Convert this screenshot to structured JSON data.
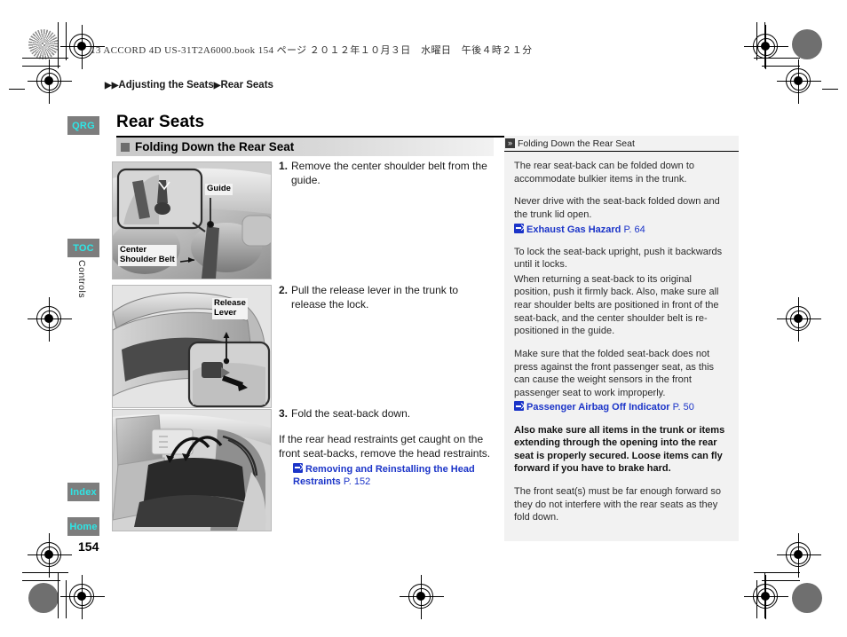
{
  "print_header": "13 ACCORD 4D US-31T2A6000.book   154 ページ   ２０１２年１０月３日　水曜日　午後４時２１分",
  "breadcrumb": {
    "arrow": "▶",
    "part1": "Adjusting the Seats",
    "part2": "Rear Seats"
  },
  "side_tabs": [
    {
      "label": "QRG"
    },
    {
      "label": "TOC"
    },
    {
      "label": "Index"
    },
    {
      "label": "Home"
    }
  ],
  "side_vertical_label": "Controls",
  "page_number": "154",
  "main": {
    "title": "Rear Seats",
    "section_heading": "Folding Down the Rear Seat",
    "steps": [
      {
        "num": "1.",
        "text": "Remove the center shoulder belt from the guide."
      },
      {
        "num": "2.",
        "text": "Pull the release lever in the trunk to release the lock."
      },
      {
        "num": "3.",
        "text": "Fold the seat-back down."
      }
    ],
    "note_text": "If the rear head restraints get caught on the front seat-backs, remove the head restraints.",
    "note_link": {
      "label": "Removing and Reinstalling the Head Restraints",
      "page": "P. 152"
    }
  },
  "figures": [
    {
      "name": "center-shoulder-belt-guide",
      "callouts": [
        {
          "text": "Guide"
        },
        {
          "text": "Center\nShoulder Belt"
        }
      ]
    },
    {
      "name": "trunk-release-lever",
      "callouts": [
        {
          "text": "Release\nLever"
        }
      ]
    },
    {
      "name": "folded-rear-seat-back",
      "callouts": []
    }
  ],
  "panel": {
    "header": "Folding Down the Rear Seat",
    "header_icon": "chevron-double-right-icon",
    "paragraphs": [
      {
        "text": "The rear seat-back can be folded down to accommodate bulkier items in the trunk.",
        "bold": false
      },
      {
        "text": "Never drive with the seat-back folded down and the trunk lid open.",
        "bold": false
      },
      {
        "text": "To lock the seat-back upright, push it backwards until it locks.",
        "bold": false
      },
      {
        "text": "When returning a seat-back to its original position, push it firmly back. Also, make sure all rear shoulder belts are positioned in front of the seat-back, and the center shoulder belt is re-positioned in the guide.",
        "bold": false
      },
      {
        "text": "Make sure that the folded seat-back does not press against the front passenger seat, as this can cause the weight sensors in the front passenger seat to work improperly.",
        "bold": false
      },
      {
        "text": "Also make sure all items in the trunk or items extending through the opening into the rear seat is properly secured. Loose items can fly forward if you have to brake hard.",
        "bold": true
      },
      {
        "text": "The front seat(s) must be far enough forward so they do not interfere with the rear seats as they fold down.",
        "bold": false
      }
    ],
    "links": [
      {
        "label": "Exhaust Gas Hazard",
        "page": "P. 64"
      },
      {
        "label": "Passenger Airbag Off Indicator",
        "page": "P. 50"
      }
    ]
  },
  "colors": {
    "tab_bg": "#7d7d7d",
    "tab_text": "#2ee6e6",
    "link": "#1b34c8",
    "panel_bg": "#f2f2f2",
    "heading_bar": "#c9c9c9"
  }
}
